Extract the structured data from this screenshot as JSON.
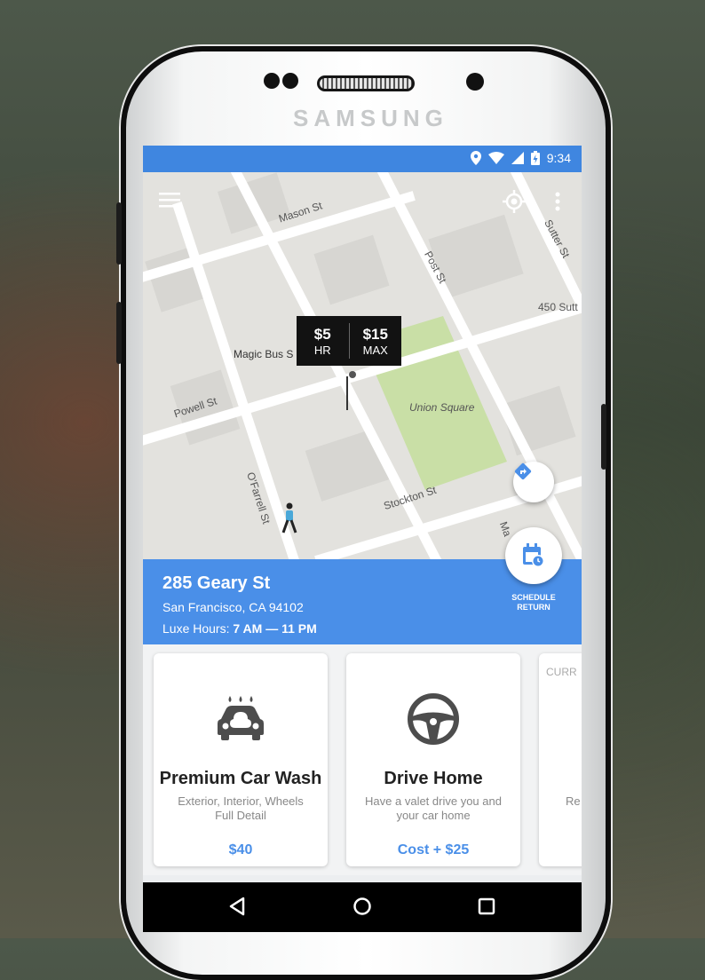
{
  "device": {
    "brand": "SAMSUNG"
  },
  "status_bar": {
    "time": "9:34",
    "icons": [
      "location-icon",
      "wifi-icon",
      "signal-icon",
      "battery-icon"
    ]
  },
  "map": {
    "streets": [
      "Mason St",
      "Post St",
      "Sutter St",
      "450 Sutt",
      "Magic Bus S",
      "Powell St",
      "Union Square",
      "O'Farrell St",
      "Stockton St",
      "Ma"
    ],
    "price_pin": {
      "hourly": "$5",
      "hourly_unit": "HR",
      "max": "$15",
      "max_unit": "MAX"
    }
  },
  "location": {
    "address": "285 Geary St",
    "city": "San Francisco, CA 94102",
    "hours_label": "Luxe Hours:",
    "hours": "7 AM — 11 PM"
  },
  "schedule_return": {
    "line1": "SCHEDULE",
    "line2": "RETURN"
  },
  "services": [
    {
      "title": "Premium Car Wash",
      "desc_line1": "Exterior, Interior, Wheels",
      "desc_line2": "Full Detail",
      "price": "$40",
      "icon": "car-wash-icon"
    },
    {
      "title": "Drive Home",
      "desc_line1": "Have a valet drive you and",
      "desc_line2": "your car home",
      "price": "Cost + $25",
      "icon": "steering-wheel-icon"
    },
    {
      "label_partial": "CURR",
      "desc_partial": "Re"
    }
  ],
  "colors": {
    "accent": "#4a8fe8",
    "status_bar": "#3f86e0",
    "park": "#c9dfa6"
  }
}
